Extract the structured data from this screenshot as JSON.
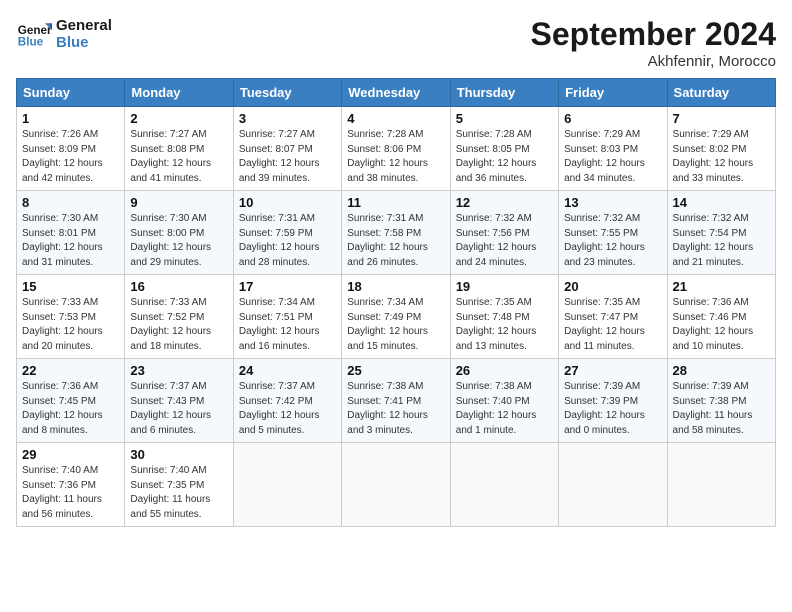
{
  "header": {
    "logo_line1": "General",
    "logo_line2": "Blue",
    "main_title": "September 2024",
    "subtitle": "Akhfennir, Morocco"
  },
  "weekdays": [
    "Sunday",
    "Monday",
    "Tuesday",
    "Wednesday",
    "Thursday",
    "Friday",
    "Saturday"
  ],
  "weeks": [
    [
      {
        "day": "1",
        "info": "Sunrise: 7:26 AM\nSunset: 8:09 PM\nDaylight: 12 hours and 42 minutes."
      },
      {
        "day": "2",
        "info": "Sunrise: 7:27 AM\nSunset: 8:08 PM\nDaylight: 12 hours and 41 minutes."
      },
      {
        "day": "3",
        "info": "Sunrise: 7:27 AM\nSunset: 8:07 PM\nDaylight: 12 hours and 39 minutes."
      },
      {
        "day": "4",
        "info": "Sunrise: 7:28 AM\nSunset: 8:06 PM\nDaylight: 12 hours and 38 minutes."
      },
      {
        "day": "5",
        "info": "Sunrise: 7:28 AM\nSunset: 8:05 PM\nDaylight: 12 hours and 36 minutes."
      },
      {
        "day": "6",
        "info": "Sunrise: 7:29 AM\nSunset: 8:03 PM\nDaylight: 12 hours and 34 minutes."
      },
      {
        "day": "7",
        "info": "Sunrise: 7:29 AM\nSunset: 8:02 PM\nDaylight: 12 hours and 33 minutes."
      }
    ],
    [
      {
        "day": "8",
        "info": "Sunrise: 7:30 AM\nSunset: 8:01 PM\nDaylight: 12 hours and 31 minutes."
      },
      {
        "day": "9",
        "info": "Sunrise: 7:30 AM\nSunset: 8:00 PM\nDaylight: 12 hours and 29 minutes."
      },
      {
        "day": "10",
        "info": "Sunrise: 7:31 AM\nSunset: 7:59 PM\nDaylight: 12 hours and 28 minutes."
      },
      {
        "day": "11",
        "info": "Sunrise: 7:31 AM\nSunset: 7:58 PM\nDaylight: 12 hours and 26 minutes."
      },
      {
        "day": "12",
        "info": "Sunrise: 7:32 AM\nSunset: 7:56 PM\nDaylight: 12 hours and 24 minutes."
      },
      {
        "day": "13",
        "info": "Sunrise: 7:32 AM\nSunset: 7:55 PM\nDaylight: 12 hours and 23 minutes."
      },
      {
        "day": "14",
        "info": "Sunrise: 7:32 AM\nSunset: 7:54 PM\nDaylight: 12 hours and 21 minutes."
      }
    ],
    [
      {
        "day": "15",
        "info": "Sunrise: 7:33 AM\nSunset: 7:53 PM\nDaylight: 12 hours and 20 minutes."
      },
      {
        "day": "16",
        "info": "Sunrise: 7:33 AM\nSunset: 7:52 PM\nDaylight: 12 hours and 18 minutes."
      },
      {
        "day": "17",
        "info": "Sunrise: 7:34 AM\nSunset: 7:51 PM\nDaylight: 12 hours and 16 minutes."
      },
      {
        "day": "18",
        "info": "Sunrise: 7:34 AM\nSunset: 7:49 PM\nDaylight: 12 hours and 15 minutes."
      },
      {
        "day": "19",
        "info": "Sunrise: 7:35 AM\nSunset: 7:48 PM\nDaylight: 12 hours and 13 minutes."
      },
      {
        "day": "20",
        "info": "Sunrise: 7:35 AM\nSunset: 7:47 PM\nDaylight: 12 hours and 11 minutes."
      },
      {
        "day": "21",
        "info": "Sunrise: 7:36 AM\nSunset: 7:46 PM\nDaylight: 12 hours and 10 minutes."
      }
    ],
    [
      {
        "day": "22",
        "info": "Sunrise: 7:36 AM\nSunset: 7:45 PM\nDaylight: 12 hours and 8 minutes."
      },
      {
        "day": "23",
        "info": "Sunrise: 7:37 AM\nSunset: 7:43 PM\nDaylight: 12 hours and 6 minutes."
      },
      {
        "day": "24",
        "info": "Sunrise: 7:37 AM\nSunset: 7:42 PM\nDaylight: 12 hours and 5 minutes."
      },
      {
        "day": "25",
        "info": "Sunrise: 7:38 AM\nSunset: 7:41 PM\nDaylight: 12 hours and 3 minutes."
      },
      {
        "day": "26",
        "info": "Sunrise: 7:38 AM\nSunset: 7:40 PM\nDaylight: 12 hours and 1 minute."
      },
      {
        "day": "27",
        "info": "Sunrise: 7:39 AM\nSunset: 7:39 PM\nDaylight: 12 hours and 0 minutes."
      },
      {
        "day": "28",
        "info": "Sunrise: 7:39 AM\nSunset: 7:38 PM\nDaylight: 11 hours and 58 minutes."
      }
    ],
    [
      {
        "day": "29",
        "info": "Sunrise: 7:40 AM\nSunset: 7:36 PM\nDaylight: 11 hours and 56 minutes."
      },
      {
        "day": "30",
        "info": "Sunrise: 7:40 AM\nSunset: 7:35 PM\nDaylight: 11 hours and 55 minutes."
      },
      {
        "day": "",
        "info": ""
      },
      {
        "day": "",
        "info": ""
      },
      {
        "day": "",
        "info": ""
      },
      {
        "day": "",
        "info": ""
      },
      {
        "day": "",
        "info": ""
      }
    ]
  ]
}
